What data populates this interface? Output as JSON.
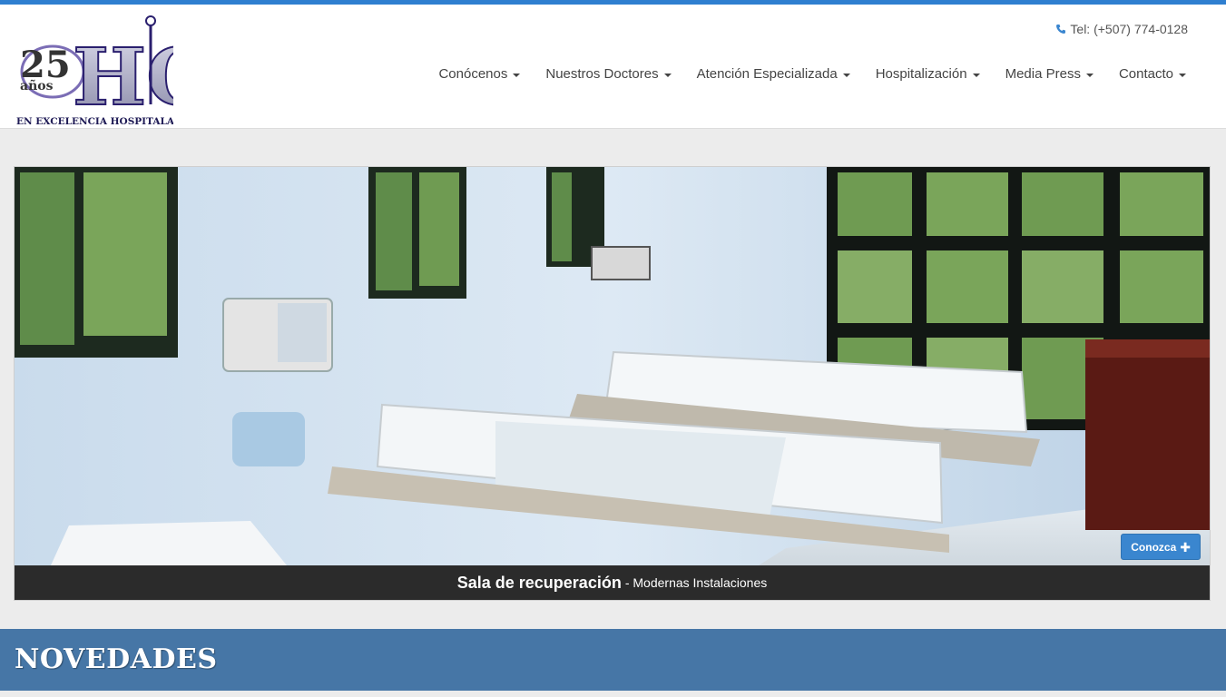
{
  "brand": {
    "logo_years": "25",
    "logo_anos": "años",
    "logo_monogram": "HC",
    "logo_tagline": "EN EXCELENCIA HOSPITALARIA"
  },
  "header": {
    "phone_icon": "phone-icon",
    "phone": "Tel: (+507) 774-0128"
  },
  "nav": {
    "items": [
      {
        "label": "Conócenos"
      },
      {
        "label": "Nuestros Doctores"
      },
      {
        "label": "Atención Especializada"
      },
      {
        "label": "Hospitalización"
      },
      {
        "label": "Media Press"
      },
      {
        "label": "Contacto"
      }
    ]
  },
  "hero": {
    "caption_title": "Sala de recuperación",
    "caption_sub": "- Modernas Instalaciones",
    "cta_label": "Conozca",
    "cta_icon": "plus-icon"
  },
  "section": {
    "title": "NOVEDADES"
  },
  "colors": {
    "accent": "#2f7fd0",
    "button": "#3a86cf",
    "section_band": "#4676a6",
    "caption_bg": "#2b2b2b"
  }
}
